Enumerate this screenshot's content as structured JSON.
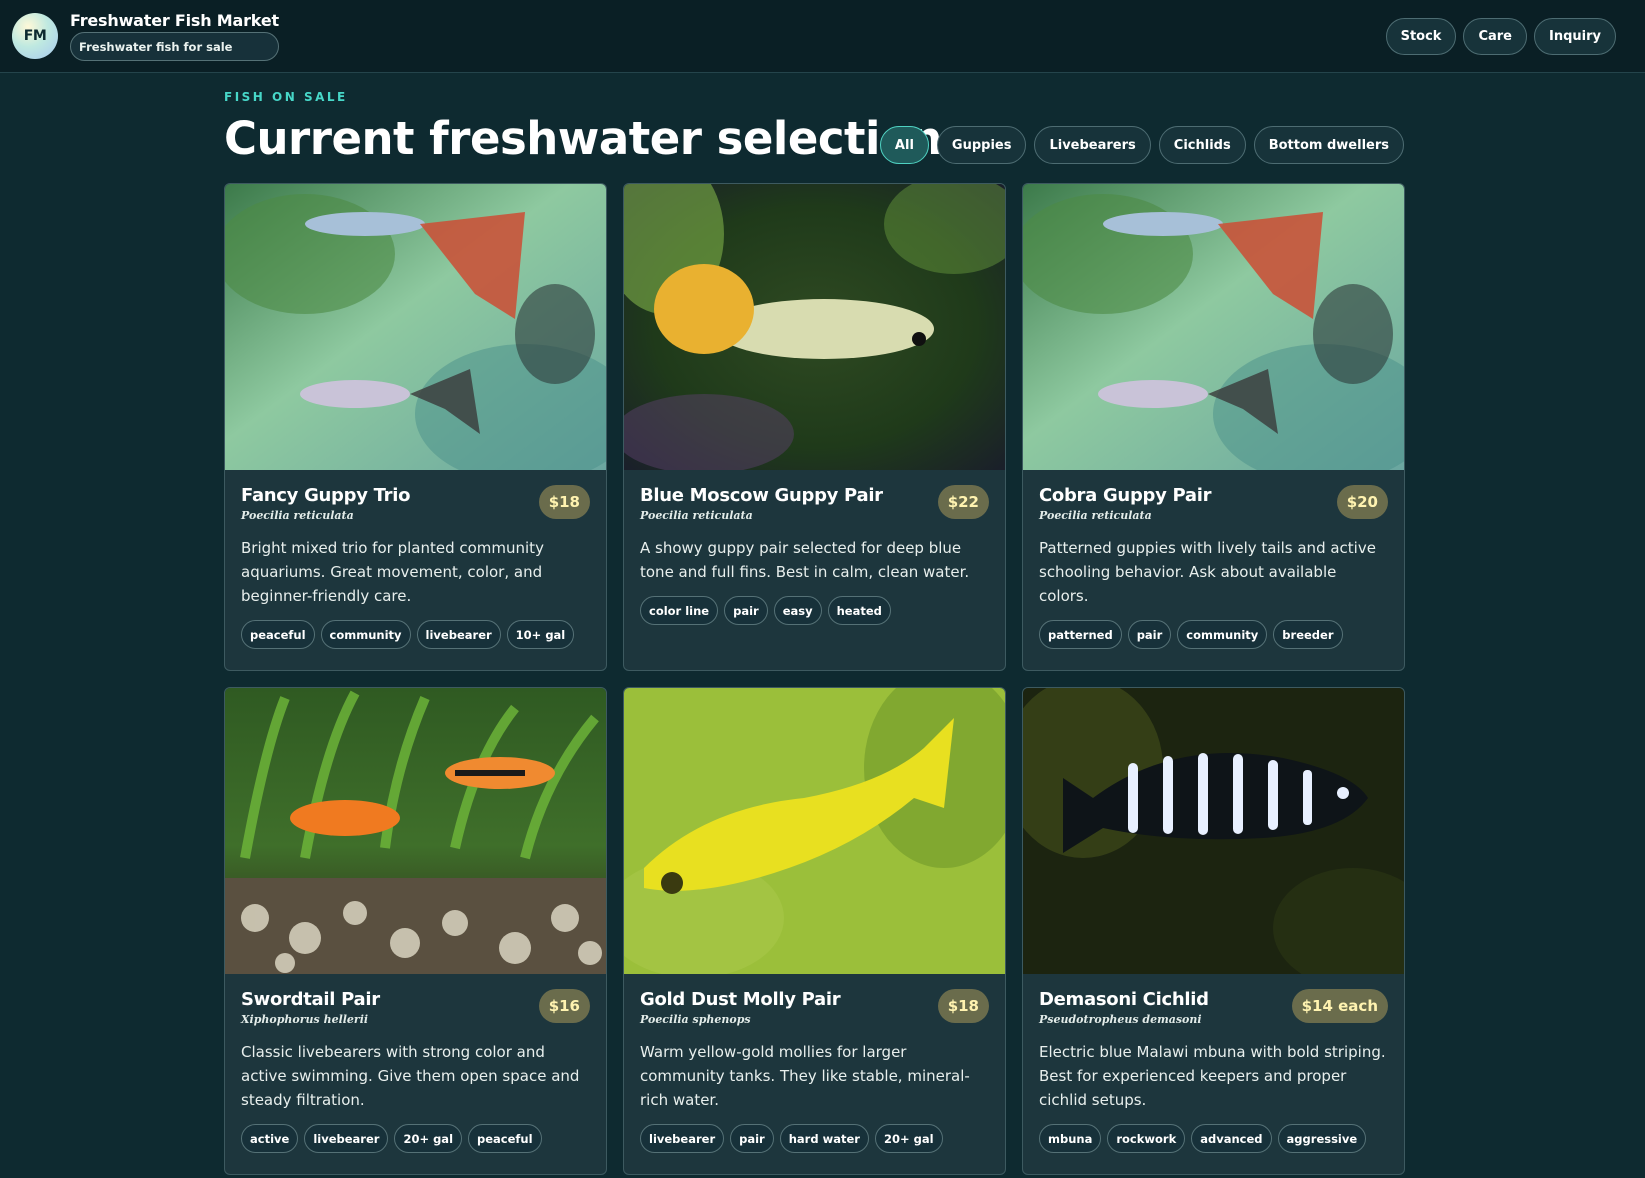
{
  "brand": {
    "logo_text": "FM",
    "name": "Freshwater Fish Market",
    "tagline": "Freshwater fish for sale"
  },
  "nav": [
    "Stock",
    "Care",
    "Inquiry"
  ],
  "section": {
    "eyebrow": "FISH ON SALE",
    "title": "Current freshwater selection"
  },
  "filters": [
    "All",
    "Guppies",
    "Livebearers",
    "Cichlids",
    "Bottom dwellers"
  ],
  "active_filter": "All",
  "products": [
    {
      "name": "Fancy Guppy Trio",
      "scientific": "Poecilia reticulata",
      "price": "$18",
      "description": "Bright mixed trio for planted community aquariums. Great movement, color, and beginner-friendly care.",
      "tags": [
        "peaceful",
        "community",
        "livebearer",
        "10+ gal"
      ],
      "photo": "guppy-pair-photo"
    },
    {
      "name": "Blue Moscow Guppy Pair",
      "scientific": "Poecilia reticulata",
      "price": "$22",
      "description": "A showy guppy pair selected for deep blue tone and full fins. Best in calm, clean water.",
      "tags": [
        "color line",
        "pair",
        "easy",
        "heated"
      ],
      "photo": "single-guppy-photo"
    },
    {
      "name": "Cobra Guppy Pair",
      "scientific": "Poecilia reticulata",
      "price": "$20",
      "description": "Patterned guppies with lively tails and active schooling behavior. Ask about available colors.",
      "tags": [
        "patterned",
        "pair",
        "community",
        "breeder"
      ],
      "photo": "guppy-pair-photo"
    },
    {
      "name": "Swordtail Pair",
      "scientific": "Xiphophorus hellerii",
      "price": "$16",
      "description": "Classic livebearers with strong color and active swimming. Give them open space and steady filtration.",
      "tags": [
        "active",
        "livebearer",
        "20+ gal",
        "peaceful"
      ],
      "photo": "swordtail-photo"
    },
    {
      "name": "Gold Dust Molly Pair",
      "scientific": "Poecilia sphenops",
      "price": "$18",
      "description": "Warm yellow-gold mollies for larger community tanks. They like stable, mineral-rich water.",
      "tags": [
        "livebearer",
        "pair",
        "hard water",
        "20+ gal"
      ],
      "photo": "molly-photo"
    },
    {
      "name": "Demasoni Cichlid",
      "scientific": "Pseudotropheus demasoni",
      "price": "$14 each",
      "description": "Electric blue Malawi mbuna with bold striping. Best for experienced keepers and proper cichlid setups.",
      "tags": [
        "mbuna",
        "rockwork",
        "advanced",
        "aggressive"
      ],
      "photo": "cichlid-photo"
    }
  ],
  "colors": {
    "background": "#0e2a30",
    "accent": "#47d7c8",
    "price_badge": "#6a6c4c"
  }
}
